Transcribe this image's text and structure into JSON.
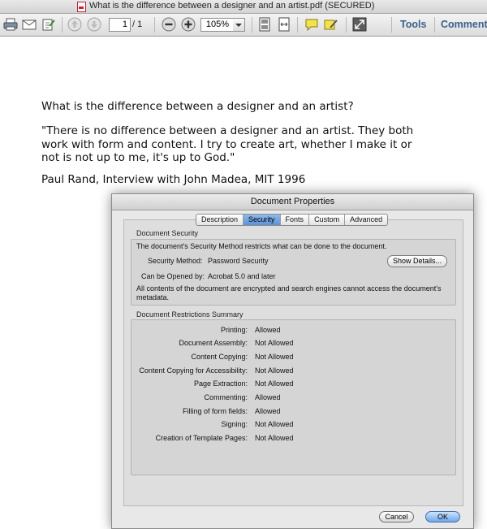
{
  "window": {
    "title": "What is the difference between a designer and an artist.pdf (SECURED)"
  },
  "toolbar": {
    "page_current": "1",
    "page_total": "/ 1",
    "zoom": "105%",
    "tools_label": "Tools",
    "comment_label": "Comment"
  },
  "document": {
    "question": "What is the difference between a designer and an artist?",
    "quote_lines": [
      "\"There is no difference between a designer and an artist. They both",
      "work with form and content. I try to create art, whether I make it or",
      "not is not up to me, it's up to God.\""
    ],
    "attribution": "Paul Rand, Interview with John Madea, MIT 1996"
  },
  "dialog": {
    "title": "Document Properties",
    "tabs": [
      "Description",
      "Security",
      "Fonts",
      "Custom",
      "Advanced"
    ],
    "active_tab": "Security",
    "security": {
      "group_label": "Document Security",
      "intro": "The document's Security Method restricts what can be done to the document.",
      "method_label": "Security Method:",
      "method_value": "Password Security",
      "show_details": "Show Details...",
      "opened_by_label": "Can be Opened by:",
      "opened_by_value": "Acrobat 5.0 and later",
      "encryption_note": "All contents of the document are encrypted and search engines cannot access the document's metadata."
    },
    "restrictions": {
      "group_label": "Document Restrictions Summary",
      "rows": [
        {
          "label": "Printing:",
          "value": "Allowed"
        },
        {
          "label": "Document Assembly:",
          "value": "Not Allowed"
        },
        {
          "label": "Content Copying:",
          "value": "Not Allowed"
        },
        {
          "label": "Content Copying for Accessibility:",
          "value": "Not Allowed"
        },
        {
          "label": "Page Extraction:",
          "value": "Not Allowed"
        },
        {
          "label": "Commenting:",
          "value": "Allowed"
        },
        {
          "label": "Filling of form fields:",
          "value": "Allowed"
        },
        {
          "label": "Signing:",
          "value": "Not Allowed"
        },
        {
          "label": "Creation of Template Pages:",
          "value": "Not Allowed"
        }
      ]
    },
    "buttons": {
      "cancel": "Cancel",
      "ok": "OK"
    }
  }
}
